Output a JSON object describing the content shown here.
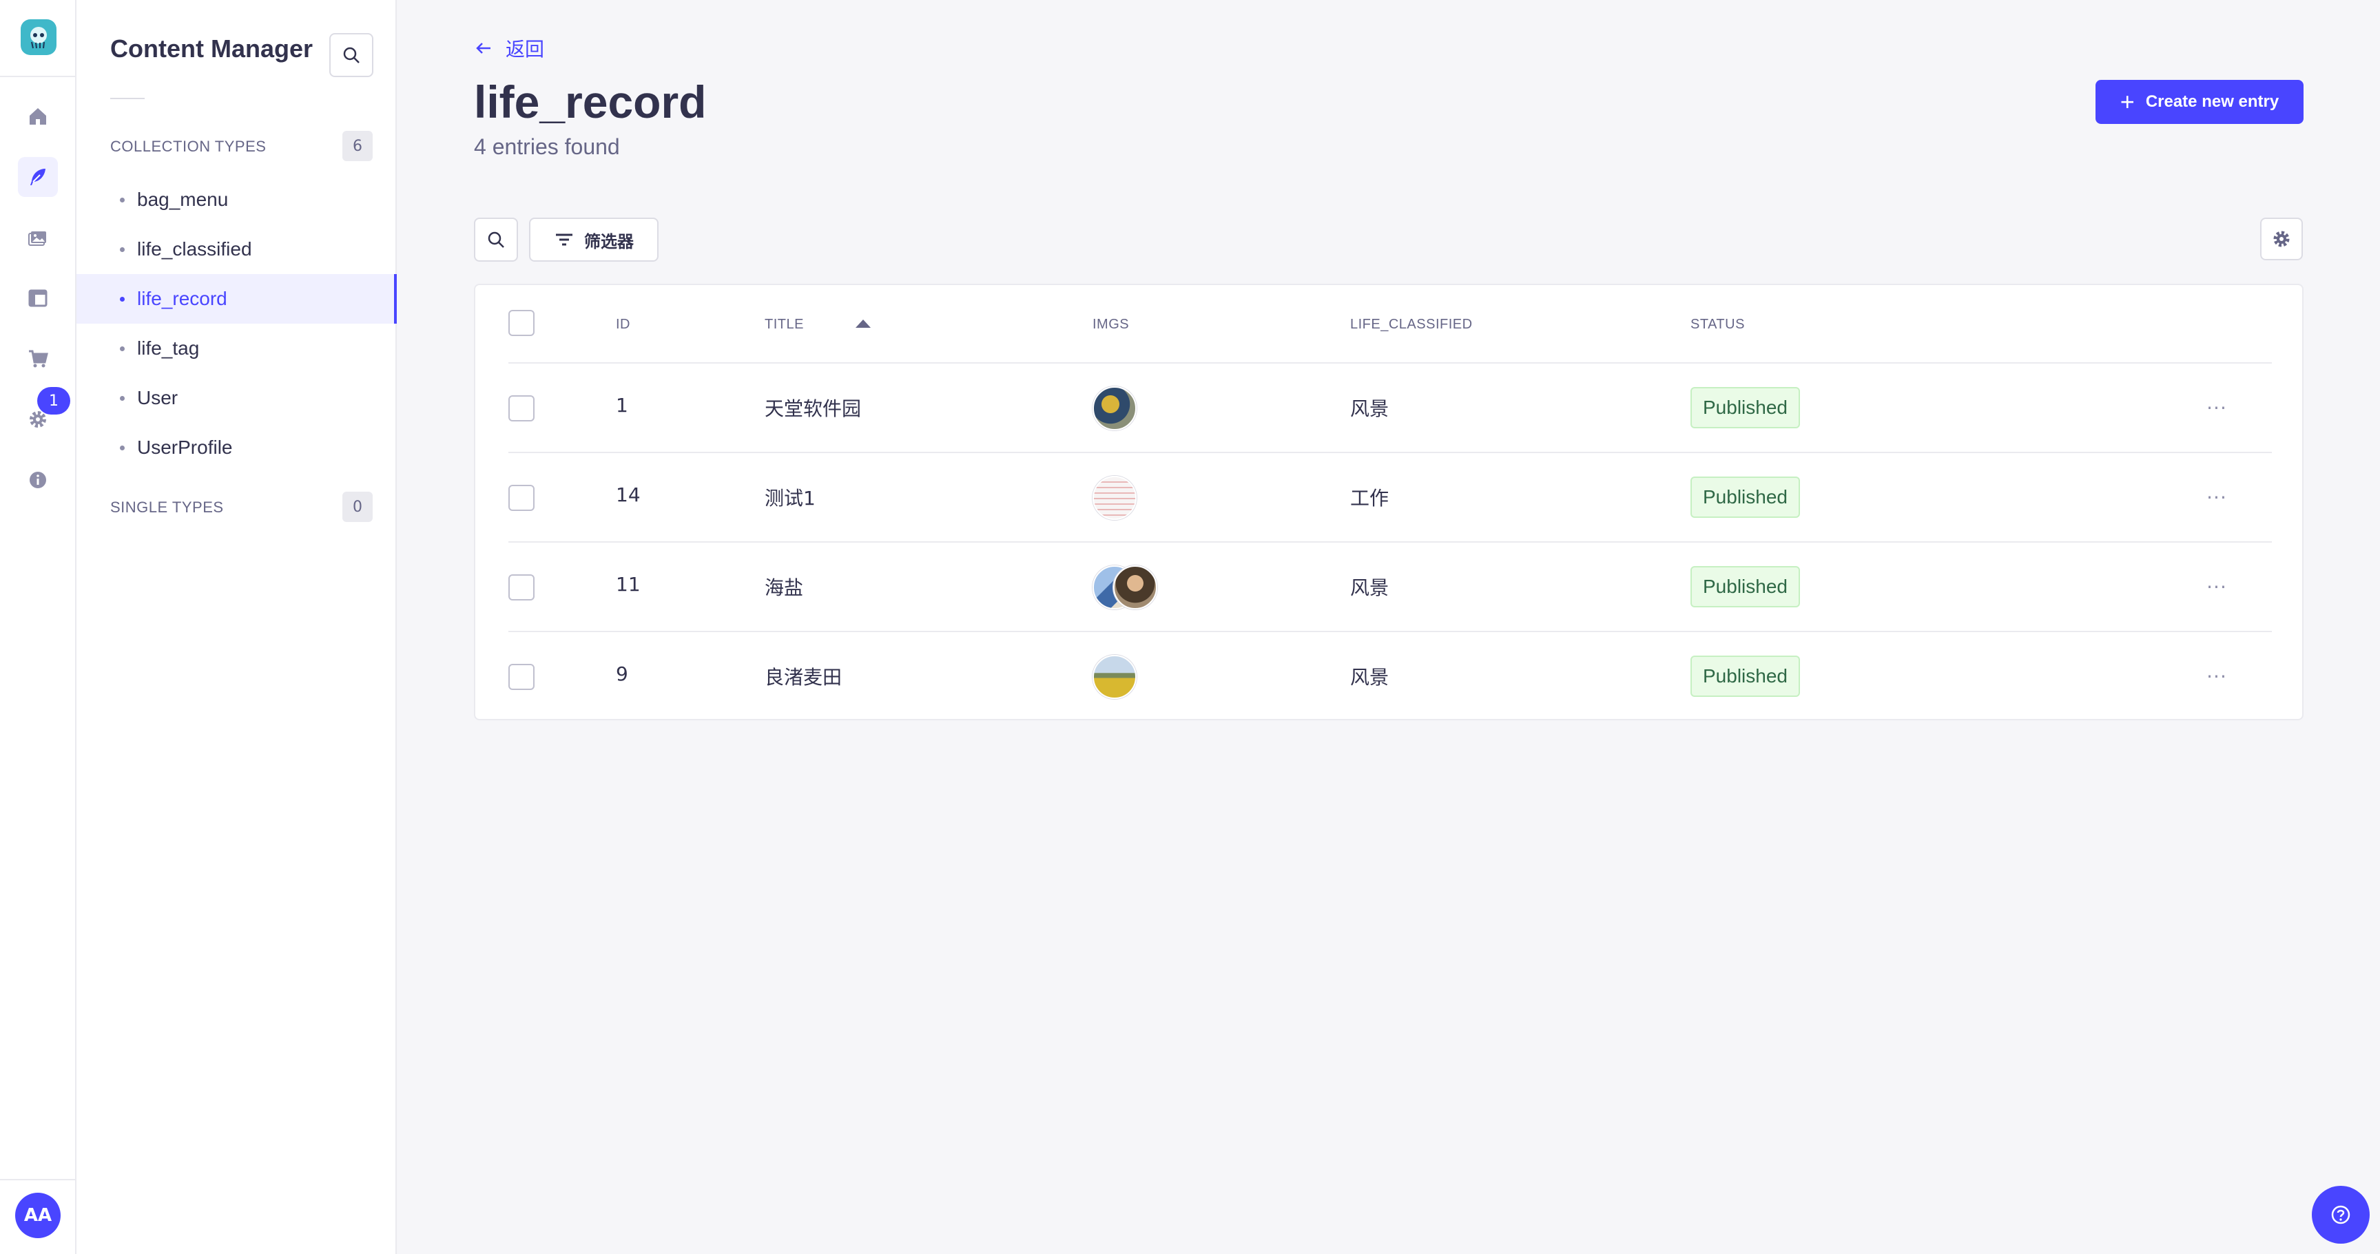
{
  "rail": {
    "logo": "strapi-logo-icon",
    "items": [
      {
        "name": "home-icon",
        "active": false
      },
      {
        "name": "content-manager-feather-icon",
        "active": true
      },
      {
        "name": "media-library-icon",
        "active": false
      },
      {
        "name": "content-type-builder-icon",
        "active": false
      },
      {
        "name": "marketplace-cart-icon",
        "active": false
      },
      {
        "name": "settings-gear-icon",
        "active": false
      },
      {
        "name": "info-icon",
        "active": false
      }
    ],
    "settings_badge": "1",
    "avatar_initials": "AA"
  },
  "subnav": {
    "title": "Content Manager",
    "collection_types_label": "COLLECTION TYPES",
    "collection_types_count": "6",
    "collection_types": [
      {
        "label": "bag_menu",
        "active": false
      },
      {
        "label": "life_classified",
        "active": false
      },
      {
        "label": "life_record",
        "active": true
      },
      {
        "label": "life_tag",
        "active": false
      },
      {
        "label": "User",
        "active": false
      },
      {
        "label": "UserProfile",
        "active": false
      }
    ],
    "single_types_label": "SINGLE TYPES",
    "single_types_count": "0"
  },
  "header": {
    "back_label": "返回",
    "title": "life_record",
    "subtitle": "4 entries found",
    "create_label": "Create new entry"
  },
  "toolbar": {
    "filter_label": "筛选器"
  },
  "table": {
    "columns": [
      "ID",
      "TITLE",
      "IMGS",
      "LIFE_CLASSIFIED",
      "STATUS"
    ],
    "sorted_column": "TITLE",
    "sort_direction": "ascending",
    "rows": [
      {
        "id": "1",
        "title": "天堂软件园",
        "imgs": [
          "#5a6b4a"
        ],
        "classified": "风景",
        "status": "Published"
      },
      {
        "id": "14",
        "title": "测试1",
        "imgs": [
          "#f4f0f0"
        ],
        "classified": "工作",
        "status": "Published"
      },
      {
        "id": "11",
        "title": "海盐",
        "imgs": [
          "#6a8fc4",
          "#7a5a3c"
        ],
        "classified": "风景",
        "status": "Published"
      },
      {
        "id": "9",
        "title": "良渚麦田",
        "imgs": [
          "#c8a838"
        ],
        "classified": "风景",
        "status": "Published"
      }
    ]
  },
  "colors": {
    "accent": "#4945ff",
    "published_bg": "#eafbe7",
    "published_text": "#2f6846"
  }
}
